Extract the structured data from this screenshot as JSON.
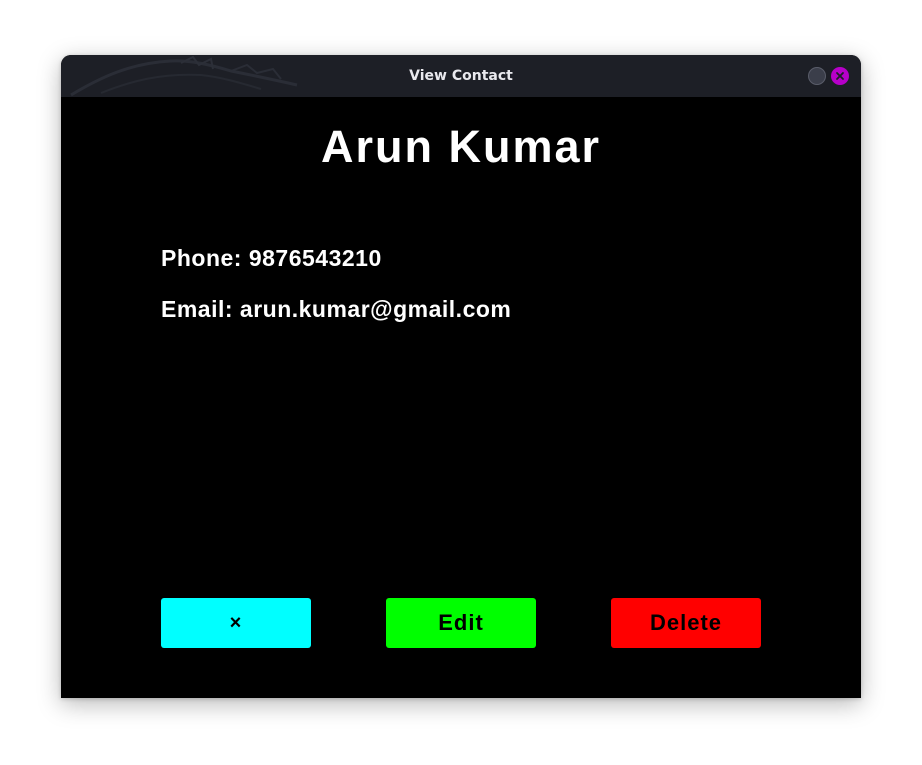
{
  "window": {
    "title": "View Contact",
    "titlebar_color": "#1d1f26",
    "close_button_color": "#b700c9"
  },
  "contact": {
    "name": "Arun Kumar",
    "phone_line": "Phone: 9876543210",
    "email_line": "Email: arun.kumar@gmail.com"
  },
  "buttons": {
    "close_label": "×",
    "edit_label": "Edit",
    "delete_label": "Delete",
    "colors": {
      "close": "#00ffff",
      "edit": "#00ff00",
      "delete": "#ff0000"
    }
  }
}
